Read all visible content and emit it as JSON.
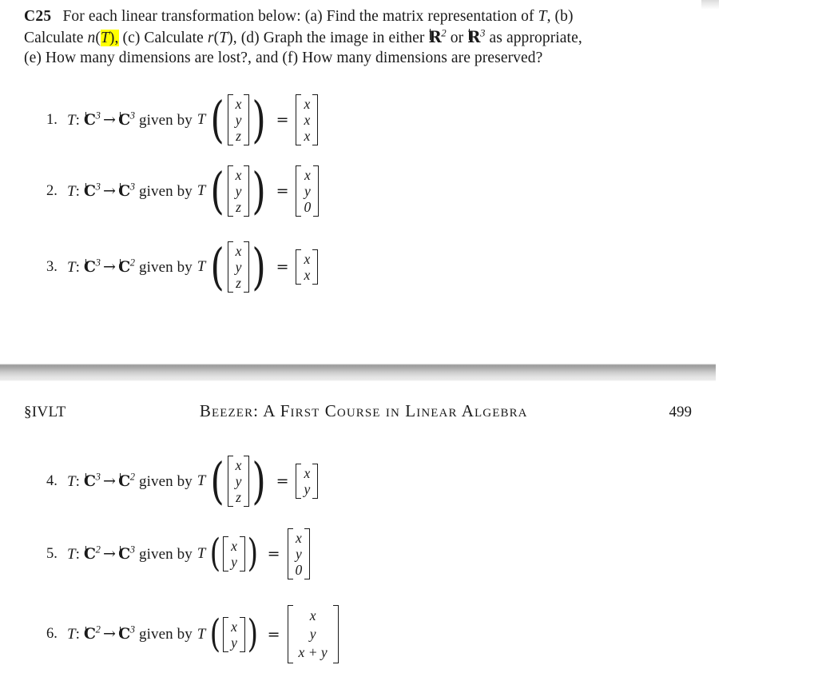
{
  "exercise": {
    "tag": "C25",
    "line1_a": "For each linear transformation below: (a) Find the matrix representation of ",
    "line1_T": "T",
    "line1_b": ", (b)",
    "line2_a": "Calculate ",
    "line2_n": "n",
    "line2_paren_open": "(",
    "line2_highlight_T": "T",
    "line2_highlight_tail": "),",
    "line2_c": " (c) Calculate ",
    "line2_r": "r",
    "line2_rT": "(T)",
    "line2_d": ", (d) Graph the image in either ",
    "line2_R2": "R",
    "line2_R2_exp": "2",
    "line2_or": " or ",
    "line2_R3": "R",
    "line2_R3_exp": "3",
    "line2_end": " as appropriate,",
    "line3": "(e) How many dimensions are lost?, and (f) How many dimensions are preserved?"
  },
  "items": [
    {
      "number": "1.",
      "map_T": "T",
      "colon": ":",
      "domain": "C",
      "domain_exp": "3",
      "arrow": "→",
      "codomain": "C",
      "codomain_exp": "3",
      "given_by": "given by",
      "fn": "T",
      "input": [
        "x",
        "y",
        "z"
      ],
      "equals": "=",
      "output": [
        "x",
        "x",
        "x"
      ]
    },
    {
      "number": "2.",
      "map_T": "T",
      "colon": ":",
      "domain": "C",
      "domain_exp": "3",
      "arrow": "→",
      "codomain": "C",
      "codomain_exp": "3",
      "given_by": "given by",
      "fn": "T",
      "input": [
        "x",
        "y",
        "z"
      ],
      "equals": "=",
      "output": [
        "x",
        "y",
        "0"
      ]
    },
    {
      "number": "3.",
      "map_T": "T",
      "colon": ":",
      "domain": "C",
      "domain_exp": "3",
      "arrow": "→",
      "codomain": "C",
      "codomain_exp": "2",
      "given_by": "given by",
      "fn": "T",
      "input": [
        "x",
        "y",
        "z"
      ],
      "equals": "=",
      "output": [
        "x",
        "x"
      ]
    },
    {
      "number": "4.",
      "map_T": "T",
      "colon": ":",
      "domain": "C",
      "domain_exp": "3",
      "arrow": "→",
      "codomain": "C",
      "codomain_exp": "2",
      "given_by": "given by",
      "fn": "T",
      "input": [
        "x",
        "y",
        "z"
      ],
      "equals": "=",
      "output": [
        "x",
        "y"
      ]
    },
    {
      "number": "5.",
      "map_T": "T",
      "colon": ":",
      "domain": "C",
      "domain_exp": "2",
      "arrow": "→",
      "codomain": "C",
      "codomain_exp": "3",
      "given_by": "given by",
      "fn": "T",
      "input": [
        "x",
        "y"
      ],
      "equals": "=",
      "output": [
        "x",
        "y",
        "0"
      ]
    },
    {
      "number": "6.",
      "map_T": "T",
      "colon": ":",
      "domain": "C",
      "domain_exp": "2",
      "arrow": "→",
      "codomain": "C",
      "codomain_exp": "3",
      "given_by": "given by",
      "fn": "T",
      "input": [
        "x",
        "y"
      ],
      "equals": "=",
      "output": [
        "x",
        "y",
        "x + y"
      ]
    }
  ],
  "running_header": {
    "section": "§IVLT",
    "title": "Beezer: A First Course in Linear Algebra",
    "page_number": "499"
  },
  "colors": {
    "highlight": "#ffff00",
    "text": "#1a1a1a",
    "divider_dark": "#9a9a9a",
    "divider_light": "#e9e9e9"
  }
}
